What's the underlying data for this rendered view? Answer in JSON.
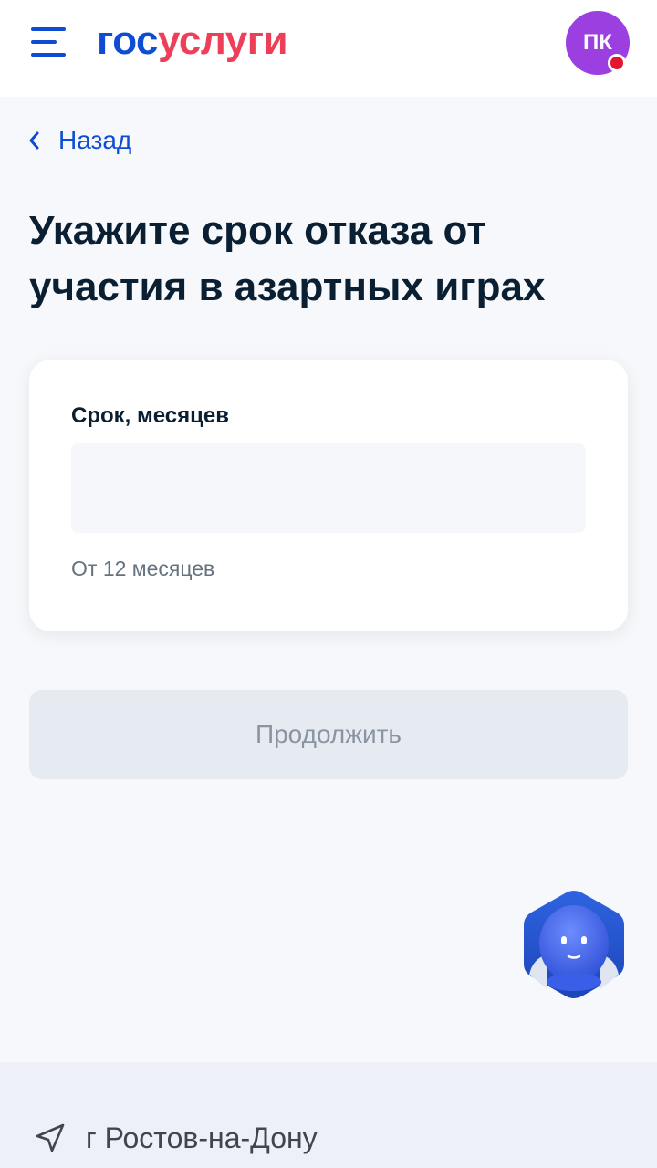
{
  "header": {
    "logo_part1": "гос",
    "logo_part2": "услуги",
    "avatar_initials": "ПК",
    "menu_icon": "burger-menu-icon"
  },
  "nav": {
    "back_label": "Назад"
  },
  "page": {
    "title": "Укажите срок отказа от участия в азартных играх"
  },
  "form": {
    "field_label": "Срок, месяцев",
    "field_value": "",
    "field_hint": "От 12 месяцев",
    "continue_label": "Продолжить",
    "continue_disabled": true
  },
  "assistant": {
    "icon": "robot-assistant-icon"
  },
  "footer": {
    "location_icon": "navigation-arrow-icon",
    "location_label": "г Ростов-на-Дону"
  },
  "colors": {
    "brand_blue": "#0d4cd3",
    "brand_red": "#ee3f58",
    "avatar_purple": "#9b3fe0",
    "notification_red": "#e2172f"
  }
}
